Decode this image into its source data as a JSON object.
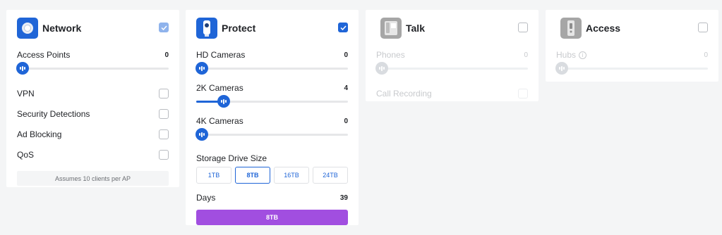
{
  "colors": {
    "accent": "#1f65d7",
    "storage_bar": "#a14ee0",
    "disabled": "#c8cacd"
  },
  "network": {
    "title": "Network",
    "icon": "network-device-icon",
    "checked": true,
    "access_points": {
      "label": "Access Points",
      "value": "0",
      "fraction": 0
    },
    "options": [
      {
        "label": "VPN",
        "checked": false
      },
      {
        "label": "Security Detections",
        "checked": false
      },
      {
        "label": "Ad Blocking",
        "checked": false
      },
      {
        "label": "QoS",
        "checked": false
      }
    ],
    "note": "Assumes 10 clients per AP"
  },
  "protect": {
    "title": "Protect",
    "icon": "camera-icon",
    "checked": true,
    "sliders": [
      {
        "label": "HD Cameras",
        "value": "0",
        "fraction": 0
      },
      {
        "label": "2K Cameras",
        "value": "4",
        "fraction": 0.18
      },
      {
        "label": "4K Cameras",
        "value": "0",
        "fraction": 0
      }
    ],
    "storage_label": "Storage Drive Size",
    "drive_options": [
      "1TB",
      "8TB",
      "16TB",
      "24TB"
    ],
    "selected_drive": "8TB",
    "days_label": "Days",
    "days_value": "39",
    "storage_bar_label": "8TB"
  },
  "talk": {
    "title": "Talk",
    "icon": "phone-icon",
    "checked": false,
    "phones": {
      "label": "Phones",
      "value": "0",
      "fraction": 0
    },
    "call_recording": {
      "label": "Call Recording",
      "checked": false
    }
  },
  "access": {
    "title": "Access",
    "icon": "door-access-icon",
    "checked": false,
    "hubs": {
      "label": "Hubs",
      "value": "0",
      "fraction": 0
    }
  }
}
